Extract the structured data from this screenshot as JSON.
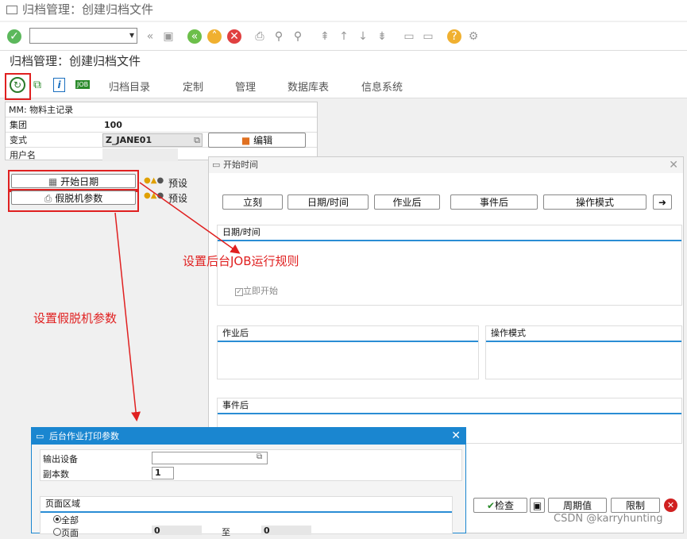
{
  "window": {
    "title": "归档管理：创建归档文件"
  },
  "toolbar": {
    "command_value": "",
    "icons": [
      "check-icon",
      "back-icon",
      "save-icon",
      "back-green-icon",
      "exit-icon",
      "cancel-icon",
      "print-icon",
      "find-icon",
      "find-next-icon",
      "first-page-icon",
      "prev-page-icon",
      "next-page-icon",
      "last-page-icon",
      "new-session-icon",
      "shortcut-icon",
      "help-icon",
      "settings-icon"
    ]
  },
  "page": {
    "title": "归档管理：创建归档文件"
  },
  "app_toolbar": {
    "job_label": "JOB",
    "menus": [
      "归档目录",
      "定制",
      "管理",
      "数据库表",
      "信息系统"
    ]
  },
  "object": {
    "header": "MM: 物料主记录",
    "fields": [
      {
        "label": "集团",
        "value": "100"
      },
      {
        "label": "变式",
        "value": "Z_JANE01"
      },
      {
        "label": "用户名",
        "value": ""
      }
    ],
    "edit_button": "编辑"
  },
  "buttons": {
    "start_date": "开始日期",
    "spool_params": "假脱机参数",
    "preset1": "预设",
    "preset2": "预设"
  },
  "annotations": {
    "job_rule": "设置后台JOB运行规则",
    "spool": "设置假脱机参数"
  },
  "start_dialog": {
    "title": "开始时间",
    "buttons": [
      "立刻",
      "日期/时间",
      "作业后",
      "事件后",
      "操作模式"
    ],
    "section_datetime": "日期/时间",
    "immediate": "立即开始",
    "section_after_job": "作业后",
    "section_opmode": "操作模式",
    "section_after_event": "事件后",
    "footer_buttons": [
      "检查",
      "周期值",
      "限制"
    ]
  },
  "print_dialog": {
    "title": "后台作业打印参数",
    "output_device_label": "输出设备",
    "output_device_value": "",
    "copies_label": "副本数",
    "copies_value": "1",
    "page_area_label": "页面区域",
    "all_label": "全部",
    "pages_label": "页面",
    "from_value": "0",
    "to_label": "至",
    "to_value": "0"
  },
  "watermark": "CSDN @karryhunting",
  "colors": {
    "accent": "#1a86d0",
    "annotation_red": "#e02020",
    "ok_green": "#5cb85c"
  }
}
